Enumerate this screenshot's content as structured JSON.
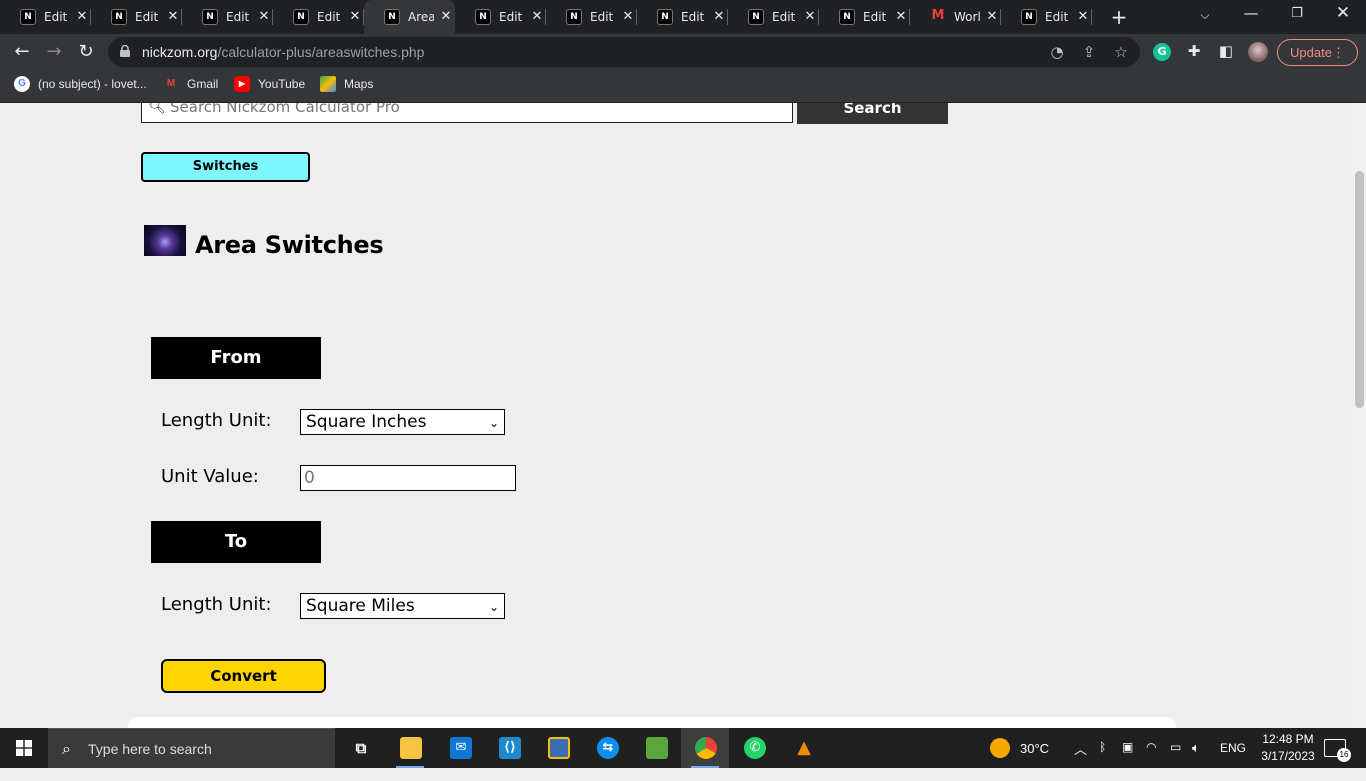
{
  "tabs": [
    {
      "title": "Edit I",
      "favicon": "nickzom-icon",
      "active": false
    },
    {
      "title": "Edit I",
      "favicon": "nickzom-icon",
      "active": false
    },
    {
      "title": "Edit I",
      "favicon": "nickzom-icon",
      "active": false
    },
    {
      "title": "Edit I",
      "favicon": "nickzom-icon",
      "active": false
    },
    {
      "title": "Area",
      "favicon": "nickzom-icon",
      "active": true
    },
    {
      "title": "Edit I",
      "favicon": "nickzom-icon",
      "active": false
    },
    {
      "title": "Edit I",
      "favicon": "nickzom-icon",
      "active": false
    },
    {
      "title": "Edit I",
      "favicon": "nickzom-icon",
      "active": false
    },
    {
      "title": "Edit I",
      "favicon": "nickzom-icon",
      "active": false
    },
    {
      "title": "Edit I",
      "favicon": "nickzom-icon",
      "active": false
    },
    {
      "title": "Worl",
      "favicon": "gmail-icon",
      "active": false
    },
    {
      "title": "Edit I",
      "favicon": "nickzom-icon",
      "active": false
    }
  ],
  "browser": {
    "url_host": "nickzom.org",
    "url_path": "/calculator-plus/areaswitches.php",
    "update_label": "Update"
  },
  "bookmarks": [
    {
      "label": "(no subject) - lovet...",
      "icon": "google-icon"
    },
    {
      "label": "Gmail",
      "icon": "gmail-icon"
    },
    {
      "label": "YouTube",
      "icon": "youtube-icon"
    },
    {
      "label": "Maps",
      "icon": "maps-icon"
    }
  ],
  "page": {
    "search_placeholder": "Search Nickzom Calculator Pro",
    "search_button": "Search",
    "switches_button": "Switches",
    "title": "Area Switches",
    "from_heading": "From",
    "from_unit_label": "Length Unit:",
    "from_unit_selected": "Square Inches",
    "unit_value_label": "Unit Value:",
    "unit_value": "0",
    "to_heading": "To",
    "to_unit_label": "Length Unit:",
    "to_unit_selected": "Square Miles",
    "convert_button": "Convert"
  },
  "taskbar": {
    "search_text": "Type here to search",
    "weather": "30°C",
    "language": "ENG",
    "time": "12:48 PM",
    "date": "3/17/2023",
    "notifications": "16"
  },
  "colors": {
    "switches_bg": "#7ff7ff",
    "convert_bg": "#ffd500",
    "section_bar": "#000000",
    "page_bg": "#eeeeee"
  }
}
